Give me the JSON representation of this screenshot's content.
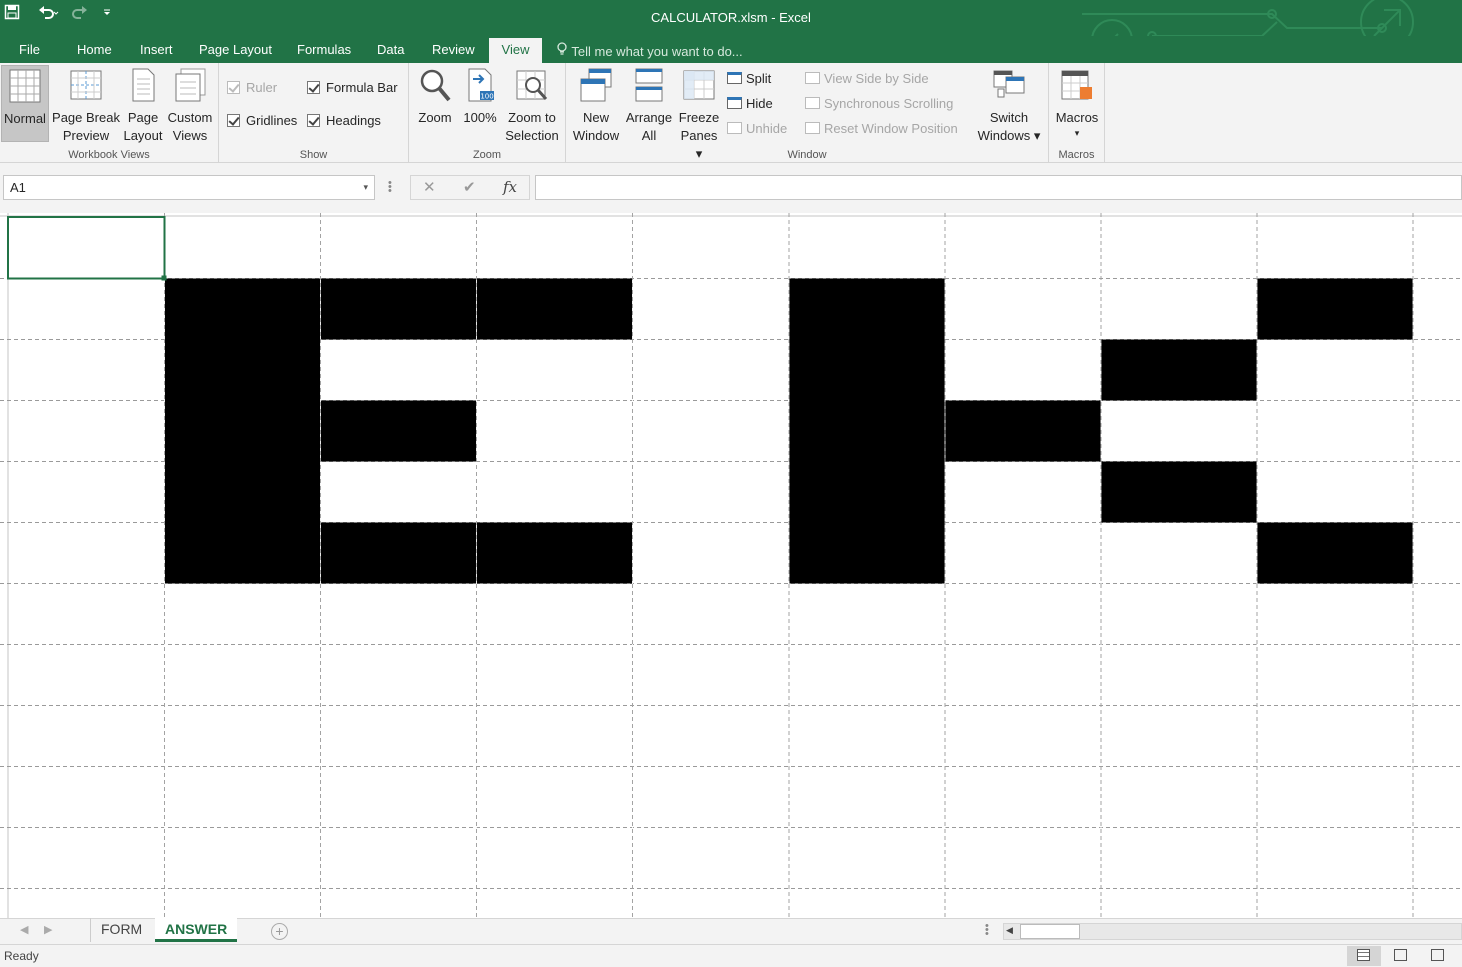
{
  "window": {
    "title": "CALCULATOR.xlsm - Excel"
  },
  "qat": {
    "save_icon": "save-icon",
    "undo_icon": "undo-icon",
    "redo_icon": "redo-icon",
    "customize_icon": "customize-qat-icon"
  },
  "tabs": [
    {
      "label": "File",
      "active": false
    },
    {
      "label": "Home",
      "active": false
    },
    {
      "label": "Insert",
      "active": false
    },
    {
      "label": "Page Layout",
      "active": false
    },
    {
      "label": "Formulas",
      "active": false
    },
    {
      "label": "Data",
      "active": false
    },
    {
      "label": "Review",
      "active": false
    },
    {
      "label": "View",
      "active": true
    }
  ],
  "tell_me": "Tell me what you want to do...",
  "ribbon": {
    "workbook_views": {
      "label": "Workbook Views",
      "normal": [
        "Normal"
      ],
      "page_break": [
        "Page Break",
        "Preview"
      ],
      "page_layout": [
        "Page",
        "Layout"
      ],
      "custom_views": [
        "Custom",
        "Views"
      ]
    },
    "show": {
      "label": "Show",
      "ruler": "Ruler",
      "formula_bar": "Formula Bar",
      "gridlines": "Gridlines",
      "headings": "Headings"
    },
    "zoom": {
      "label": "Zoom",
      "zoom": "Zoom",
      "hundred": "100%",
      "hundred_icon_text": "100",
      "zoom_selection": [
        "Zoom to",
        "Selection"
      ]
    },
    "window": {
      "label": "Window",
      "new_window": [
        "New",
        "Window"
      ],
      "arrange_all": [
        "Arrange",
        "All"
      ],
      "freeze_panes": [
        "Freeze",
        "Panes ▾"
      ],
      "split": "Split",
      "hide": "Hide",
      "unhide": "Unhide",
      "view_side_by_side": "View Side by Side",
      "sync_scrolling": "Synchronous Scrolling",
      "reset_position": "Reset Window Position",
      "switch_windows": [
        "Switch",
        "Windows ▾"
      ]
    },
    "macros": {
      "label": "Macros",
      "macros": [
        "Macros",
        "▾"
      ]
    }
  },
  "formula_bar": {
    "name_box": "A1",
    "cancel_icon": "✕",
    "enter_icon": "✔",
    "fx_icon": "fx",
    "formula": ""
  },
  "sheet": {
    "filled_cells": [
      [
        1,
        1
      ],
      [
        1,
        2
      ],
      [
        1,
        3
      ],
      [
        1,
        5
      ],
      [
        1,
        8
      ],
      [
        2,
        1
      ],
      [
        2,
        5
      ],
      [
        2,
        7
      ],
      [
        3,
        1
      ],
      [
        3,
        2
      ],
      [
        3,
        5
      ],
      [
        3,
        6
      ],
      [
        4,
        1
      ],
      [
        4,
        5
      ],
      [
        4,
        7
      ],
      [
        5,
        1
      ],
      [
        5,
        2
      ],
      [
        5,
        3
      ],
      [
        5,
        5
      ],
      [
        5,
        8
      ]
    ],
    "selected_cell": [
      0,
      0
    ],
    "fill_color": "#000000",
    "selection_color": "#217346"
  },
  "sheet_tabs": [
    {
      "label": "FORM",
      "active": false
    },
    {
      "label": "ANSWER",
      "active": true
    }
  ],
  "status": {
    "ready": "Ready"
  },
  "colors": {
    "accent": "#217346",
    "ribbon_bg": "#f3f3f3"
  }
}
